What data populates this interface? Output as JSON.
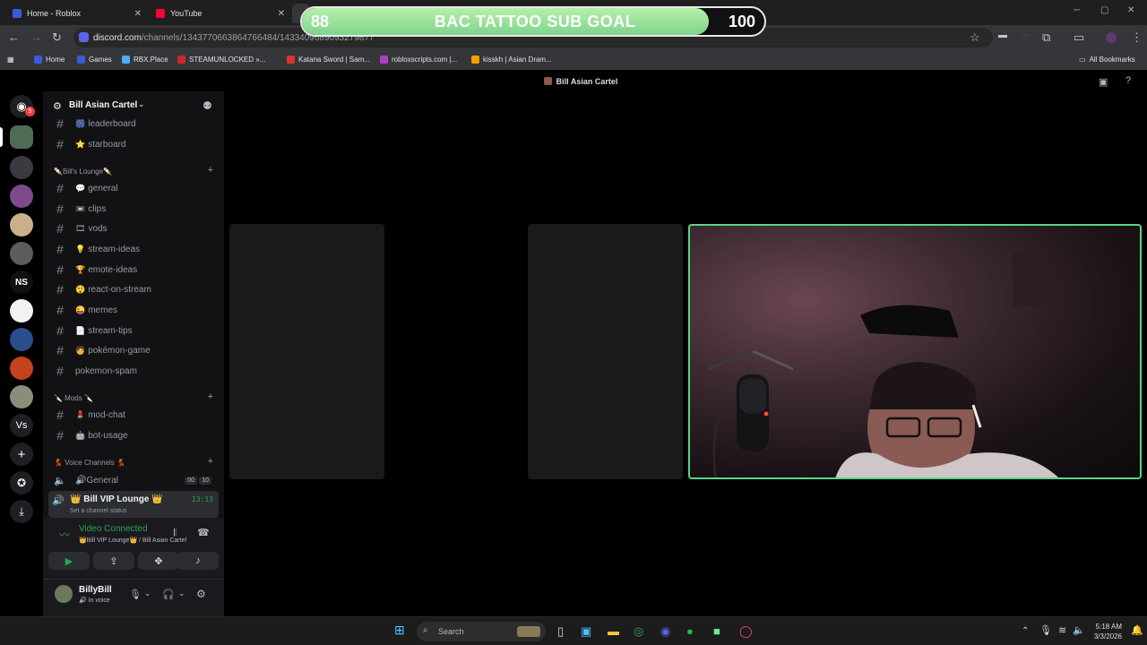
{
  "browser": {
    "tabs": [
      {
        "label": "Home - Roblox",
        "color": "#3b5bdb"
      },
      {
        "label": "YouTube",
        "color": "#ff0033"
      }
    ],
    "url": {
      "host": "discord.com",
      "path": "/channels/1343770663864766484/1433409689093279877"
    },
    "bookmarks": [
      "Home",
      "Games",
      "RBX.Place",
      "STEAMUNLOCKED »...",
      "Katana Sword | Sam...",
      "robloxscripts.com |...",
      "kisskh | Asian Dram..."
    ],
    "all_bookmarks": "All Bookmarks"
  },
  "overlay": {
    "current": "88",
    "title": "BAC TATTOO SUB GOAL",
    "target": "100",
    "progress": 0.88
  },
  "discord": {
    "window_title": "Bill Asian Cartel",
    "server_name": "Bill Asian Cartel",
    "dm_badge": "5",
    "channels_top": [
      {
        "emoji": "🎆",
        "name": "leaderboard"
      },
      {
        "emoji": "⭐",
        "name": "starboard"
      }
    ],
    "category1": "🍡Bill's Lounge🍡",
    "lounge_channels": [
      {
        "emoji": "💬",
        "name": "general"
      },
      {
        "emoji": "📼",
        "name": "clips"
      },
      {
        "emoji": "🎞",
        "name": "vods"
      },
      {
        "emoji": "💡",
        "name": "stream-ideas"
      },
      {
        "emoji": "🏆",
        "name": "emote-ideas"
      },
      {
        "emoji": "😲",
        "name": "react-on-stream"
      },
      {
        "emoji": "😜",
        "name": "memes"
      },
      {
        "emoji": "📄",
        "name": "stream-tips"
      },
      {
        "emoji": "🧑",
        "name": "pokémon-game"
      },
      {
        "emoji": "",
        "name": "pokemon-spam"
      }
    ],
    "category2": "🔪 Mods 🔪",
    "mod_channels": [
      {
        "emoji": "💄",
        "name": "mod-chat"
      },
      {
        "emoji": "🤖",
        "name": "bot-usage"
      }
    ],
    "category3": "💃 Voice Channels 💃",
    "voice_general": {
      "name": "🔊General",
      "count_a": "00",
      "count_b": "10"
    },
    "voice_vip": {
      "name": "👑 Bill VIP Lounge 👑",
      "timer": "13:13",
      "status_prompt": "Set a channel status"
    },
    "connection": {
      "status": "Video Connected",
      "location": "👑Bill VIP Lounge👑 / Bill Asian Cartel"
    },
    "user": {
      "name": "BillyBill",
      "status": "In voice"
    },
    "guild_label_ns": "NS",
    "guild_label_vs": "Vs"
  },
  "taskbar": {
    "search_placeholder": "Search",
    "time": "5:18 AM",
    "date": "3/3/2026"
  }
}
